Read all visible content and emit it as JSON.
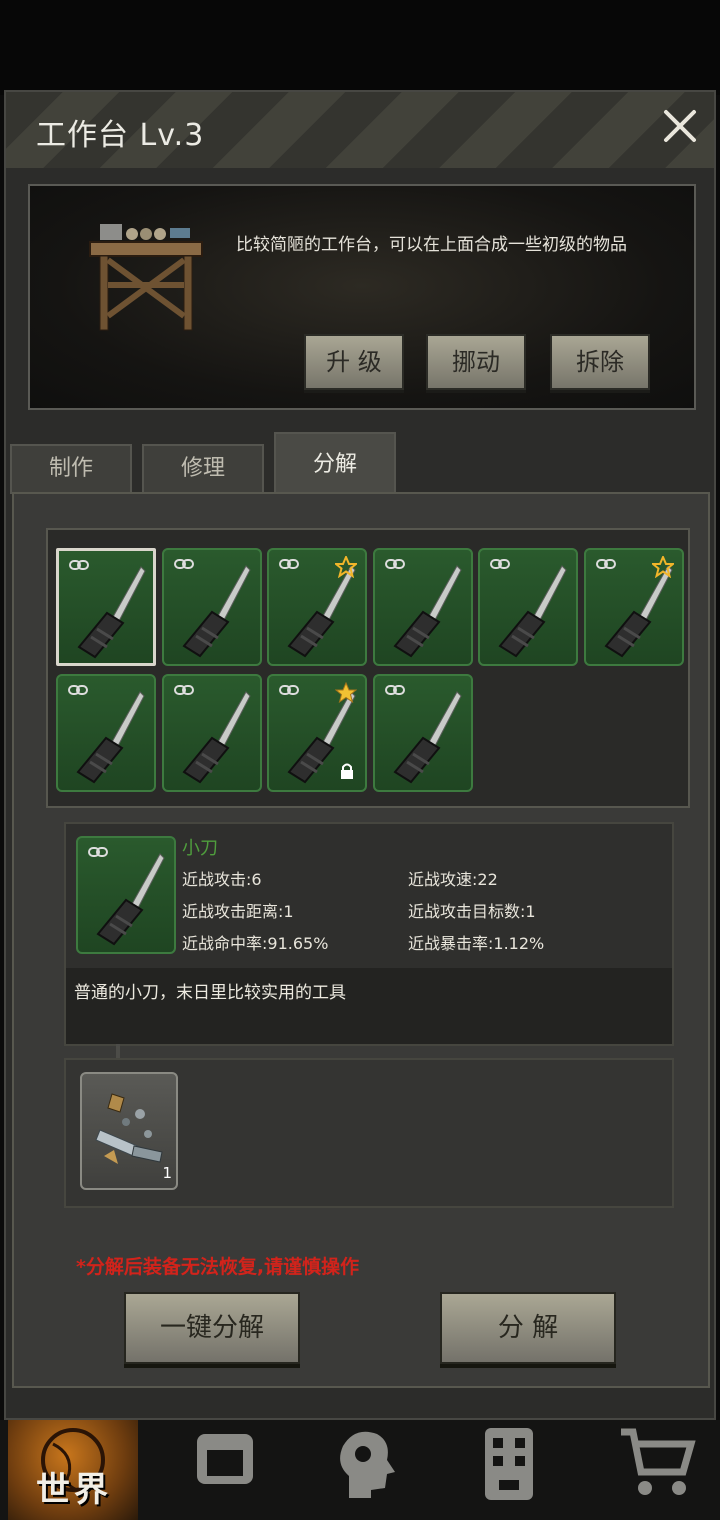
{
  "header": {
    "title": "工作台 Lv.3"
  },
  "workbench": {
    "description": "比较简陋的工作台，可以在上面合成一些初级的物品",
    "buttons": [
      "升 级",
      "挪动",
      "拆除"
    ]
  },
  "tabs": [
    {
      "label": "制作",
      "active": false
    },
    {
      "label": "修理",
      "active": false
    },
    {
      "label": "分解",
      "active": true
    }
  ],
  "items": [
    {
      "name": "knife",
      "bound": true,
      "star": "none",
      "locked": false,
      "selected": true
    },
    {
      "name": "knife",
      "bound": true,
      "star": "none",
      "locked": false,
      "selected": false
    },
    {
      "name": "knife",
      "bound": true,
      "star": "outline",
      "locked": false,
      "selected": false
    },
    {
      "name": "knife",
      "bound": true,
      "star": "none",
      "locked": false,
      "selected": false
    },
    {
      "name": "knife",
      "bound": true,
      "star": "none",
      "locked": false,
      "selected": false
    },
    {
      "name": "knife",
      "bound": true,
      "star": "outline",
      "locked": false,
      "selected": false
    },
    {
      "name": "knife",
      "bound": true,
      "star": "none",
      "locked": false,
      "selected": false
    },
    {
      "name": "knife",
      "bound": true,
      "star": "none",
      "locked": false,
      "selected": false
    },
    {
      "name": "knife",
      "bound": true,
      "star": "filled",
      "locked": true,
      "selected": false
    },
    {
      "name": "knife",
      "bound": true,
      "star": "none",
      "locked": false,
      "selected": false
    }
  ],
  "detail": {
    "name": "小刀",
    "stats": {
      "s1": "近战攻击:6",
      "s2": "近战攻速:22",
      "s3": "近战攻击距离:1",
      "s4": "近战攻击目标数:1",
      "s5": "近战命中率:91.65%",
      "s6": "近战暴击率:1.12%"
    },
    "flavor": "普通的小刀，末日里比较实用的工具"
  },
  "yield": {
    "count": "1",
    "icon": "scrap-metal-icon"
  },
  "warning": "*分解后装备无法恢复,请谨慎操作",
  "actions": {
    "auto": "一键分解",
    "dismantle": "分 解"
  },
  "nav": {
    "world": "世界",
    "icons": [
      "globe-icon",
      "backpack-icon",
      "head-icon",
      "building-icon",
      "cart-icon"
    ]
  },
  "colors": {
    "slot_green": "#2a5a2d",
    "warning": "#d2231b",
    "item_name": "#4f9e3d"
  }
}
